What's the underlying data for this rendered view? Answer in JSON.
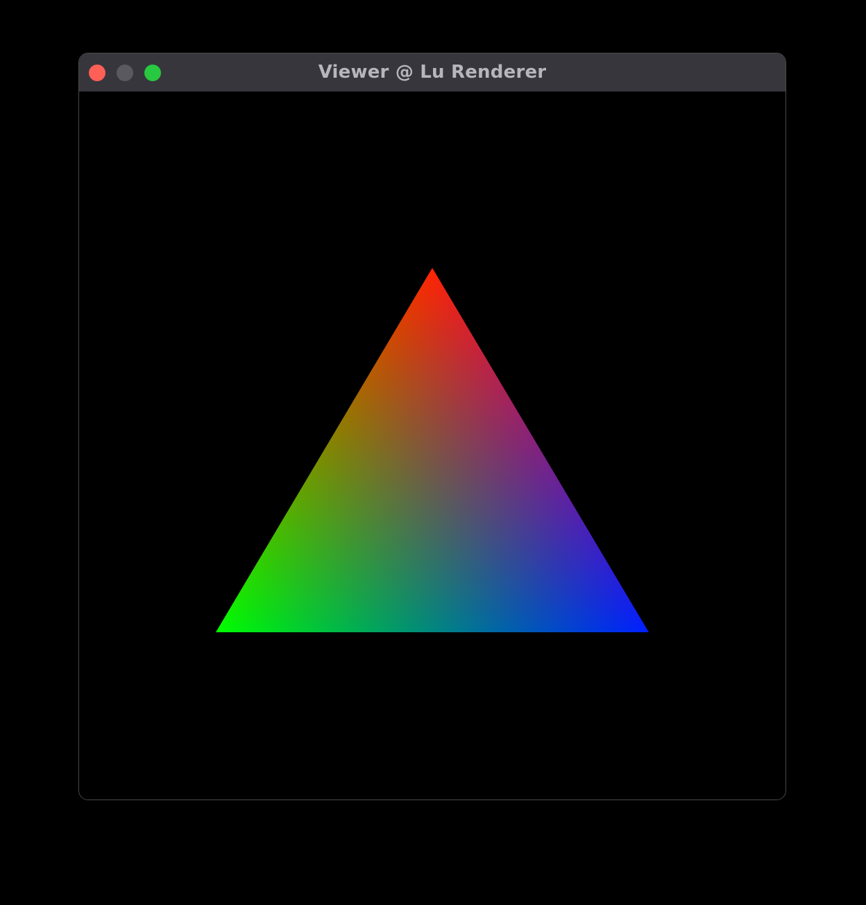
{
  "window": {
    "title": "Viewer @ Lu Renderer"
  },
  "traffic_lights": {
    "close_color": "#fe5f57",
    "minimize_color": "#5a5960",
    "zoom_color": "#28c840"
  },
  "scene": {
    "background": "#000000",
    "triangle": {
      "top_vertex_color": "#ff2000",
      "left_vertex_color": "#00ff00",
      "right_vertex_color": "#0020ff"
    }
  }
}
